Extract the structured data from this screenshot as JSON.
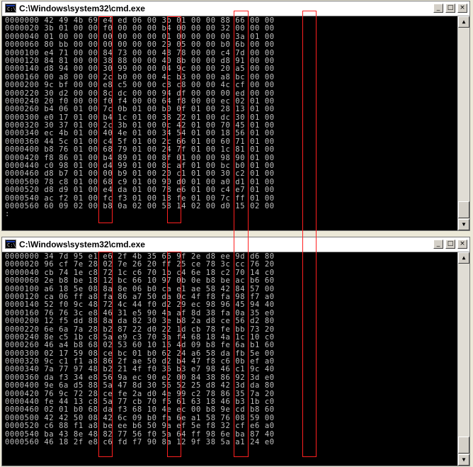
{
  "window_top": {
    "title": "C:\\Windows\\system32\\cmd.exe",
    "lines": [
      "0000000 42 49 4b 69 e4 ed 06 00 3b 01 00 00 88 66 00 00",
      "0000020 3b 01 00 00 f0 00 00 00 b4 00 00 00 32 00 00 00",
      "0000040 01 00 00 00 00 00 00 00 01 00 00 00 00 3a 01 00",
      "0000060 80 bb 00 00 00 00 00 00 29 05 00 00 b0 6b 00 00",
      "0000100 e4 71 00 00 84 73 00 00 48 78 00 00 c4 7d 00 00",
      "0000120 84 81 00 00 38 88 00 00 40 8b 00 00 d8 91 00 00",
      "0000140 d8 94 00 00 30 99 00 00 04 9c 00 00 20 a5 00 00",
      "0000160 00 a8 00 00 2c b0 00 00 4c b3 00 00 a8 bc 00 00",
      "0000200 9c bf 00 00 e8 c5 00 00 c8 c8 00 00 4c cf 00 00",
      "0000220 30 d2 00 00 8c dc 00 00 94 df 00 00 00 ed 00 00",
      "0000240 20 f0 00 00 f0 f4 00 00 64 f8 00 00 ec 02 01 00",
      "0000260 b4 06 01 00 7c 0b 01 00 b0 0f 01 00 28 13 01 00",
      "0000300 e0 17 01 00 b4 1c 01 00 38 22 01 00 dc 30 01 00",
      "0000320 30 37 01 00 2c 3b 01 00 0c 42 01 00 70 45 01 00",
      "0000340 ec 4b 01 00 40 4e 01 00 34 54 01 00 18 56 01 00",
      "0000360 44 5c 01 00 c4 5f 01 00 2c 66 01 00 60 71 01 00",
      "0000400 b8 76 01 00 68 79 01 00 24 7f 01 00 1c 81 01 00",
      "0000420 f8 86 01 00 b4 89 01 00 8f 01 00 00 98 90 01 00",
      "0000440 c0 98 01 00 d4 99 01 00 8c af 01 00 bc b0 01 00",
      "0000460 d8 b7 01 00 00 b9 01 00 20 c1 01 00 30 c2 01 00",
      "0000500 78 c8 01 00 68 c9 01 00 90 d0 01 00 a0 d1 01 00",
      "0000520 d8 d9 01 00 e4 da 01 00 78 e6 01 00 c4 e7 01 00",
      "0000540 ac f2 01 00 fc f3 01 00 18 fe 01 00 7c ff 01 00",
      "0000560 60 09 02 00 b8 0a 02 00 58 14 02 00 d0 15 02 00"
    ],
    "cursor": ":"
  },
  "window_bottom": {
    "title": "C:\\Windows\\system32\\cmd.exe",
    "lines": [
      "0000000 34 7d 95 e1 e6 2f 4b 35 66 9f 2e d8 ee 9d d6 80",
      "0000020 96 cf 7e 28 02 7e 26 20 ff 25 ce 78 3c cc 76 20",
      "0000040 cb 74 1e c8 72 1c c6 70 1b c4 6e 18 c2 70 14 c0",
      "0000060 2e b8 be 18 12 bc 66 10 97 0b 0e b8 be ac b6 60",
      "0000100 a6 18 5e 08 8a 8e 06 b0 ca e1 ae 58 42 84 57 00",
      "0000120 ca 06 ff a8 fa 86 a7 50 da 0c 4f f8 fa 98 f7 a0",
      "0000140 52 f0 9c 48 72 4c 44 f0 d2 29 ec 98 96 45 94 40",
      "0000160 76 76 3c e8 46 31 e5 90 4a af 8d 38 fa 0a 35 e0",
      "0000200 12 f5 dd 88 8a da 82 30 3e b8 2a d8 ce 56 d2 80",
      "0000220 6e 6a 7a 28 b2 87 22 d0 22 1d cb 78 fe bb 73 20",
      "0000240 8e c5 1b c8 5a e9 c3 70 3a f4 68 18 4a 1c 10 c0",
      "0000260 46 a4 b8 68 02 53 60 10 16 4d 09 b8 fe 6a b1 60",
      "0000300 02 17 59 08 ce bc 01 b0 62 24 a6 58 da fb 5e 00",
      "0000320 9c c1 f1 a8 86 2f ae 50 d2 b4 47 f8 c6 0b ef a0",
      "0000340 7a 77 97 48 b2 21 4f f0 36 b3 e7 98 46 c1 9c 40",
      "0000360 da f3 34 e8 56 9a ec 90 e2 00 84 38 86 92 3d e0",
      "0000400 9e 6a d5 88 5a 47 8d 30 56 52 25 d8 42 3d da 80",
      "0000420 76 9c 72 28 ce fe 2a d0 4e 99 c2 78 86 35 7a 20",
      "0000440 fe 44 13 c8 5a 77 cb 70 f6 61 63 18 46 b3 1b c0",
      "0000460 02 01 b0 68 da f3 68 10 4e ec 00 b8 9e cd b8 60",
      "0000500 42 42 50 08 42 6c 09 b0 fa 6e a1 58 76 08 59 00",
      "0000520 c6 88 f1 a8 be ee b6 50 9a ef 5e f8 32 cf e6 a0",
      "0000540 ba 43 8e 48 82 77 56 f0 5a 64 ff 98 6e ba 87 40",
      "0000560 46 18 2f e8 c6 fd f7 90 8a 12 9f 38 5a a1 24 e0"
    ]
  },
  "controls": {
    "minimize": "_",
    "maximize": "□",
    "close": "×"
  },
  "scroll": {
    "up": "▲",
    "down": "▼"
  },
  "icon_glyph": "C:\\",
  "highlight_color": "#ff2020"
}
